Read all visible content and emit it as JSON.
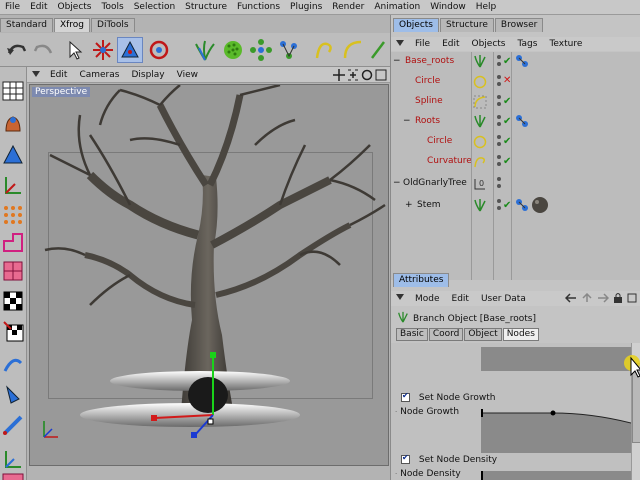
{
  "menu": [
    "File",
    "Edit",
    "Objects",
    "Tools",
    "Selection",
    "Structure",
    "Functions",
    "Plugins",
    "Render",
    "Animation",
    "Window",
    "Help"
  ],
  "palette_tabs": [
    "Standard",
    "Xfrog",
    "DiTools"
  ],
  "viewport_menu": [
    "Edit",
    "Cameras",
    "Display",
    "View"
  ],
  "viewport_label": "Perspective",
  "manager_tabs": [
    "Objects",
    "Structure",
    "Browser"
  ],
  "object_menu": [
    "File",
    "Edit",
    "Objects",
    "Tags",
    "Texture"
  ],
  "objects": [
    {
      "name": "Base_roots",
      "red": true
    },
    {
      "name": "Circle",
      "red": true
    },
    {
      "name": "Spline",
      "red": true
    },
    {
      "name": "Roots",
      "red": true
    },
    {
      "name": "Circle",
      "red": true
    },
    {
      "name": "Curvature",
      "red": true
    },
    {
      "name": "OldGnarlyTree",
      "red": false
    },
    {
      "name": "Stem",
      "red": false
    }
  ],
  "attributes_tab": "Attributes",
  "attr_menu": [
    "Mode",
    "Edit",
    "User Data"
  ],
  "attr_title": "Branch Object [Base_roots]",
  "attr_subtabs": [
    "Basic",
    "Coord",
    "Object",
    "Nodes"
  ],
  "attr_fields": {
    "set_node_growth": "Set Node Growth",
    "node_growth": "Node Growth",
    "set_node_density": "Set Node Density",
    "node_density": "Node Density"
  },
  "colors": {
    "accent": "#2b6fd6",
    "selected_name": "#b01010"
  }
}
